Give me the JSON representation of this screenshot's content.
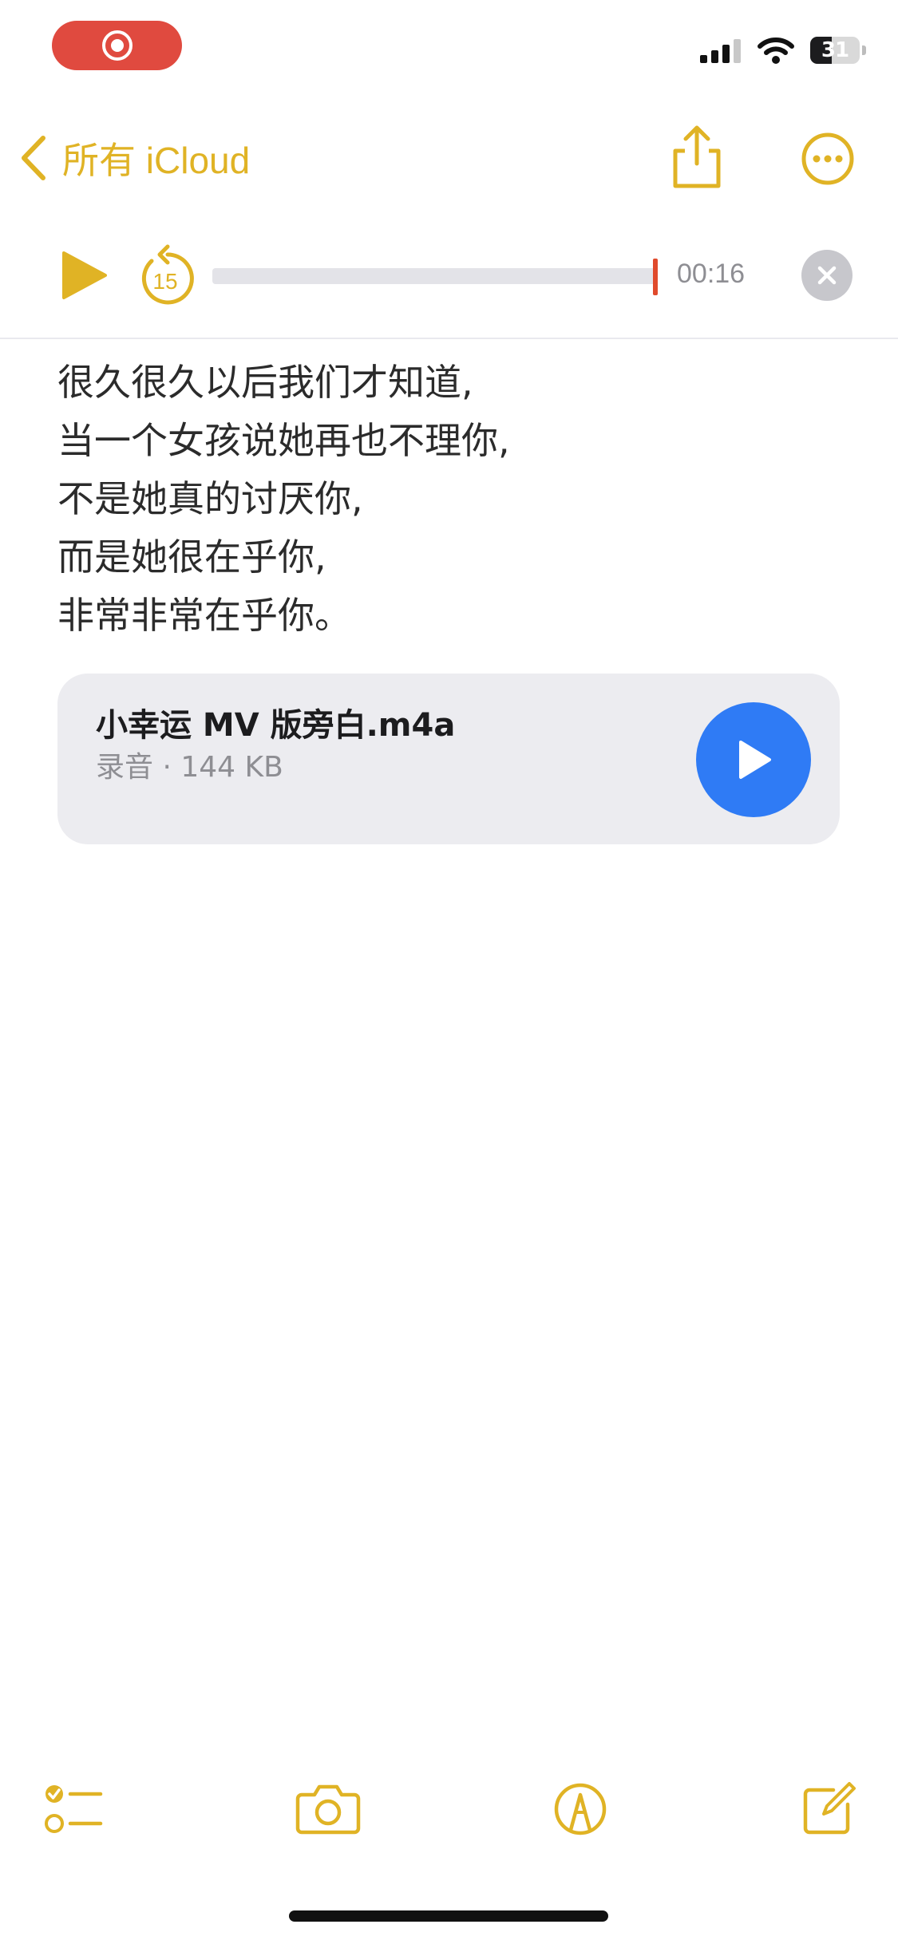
{
  "status_bar": {
    "battery_level": "31",
    "icons": [
      "screen-record-icon",
      "signal-icon",
      "wifi-icon",
      "battery-icon"
    ]
  },
  "nav": {
    "back_label": "所有 iCloud",
    "icons": [
      "chevron-left-icon",
      "share-icon",
      "more-icon"
    ]
  },
  "player": {
    "time": "00:16",
    "progress": 0.98,
    "icons": [
      "play-icon",
      "skip-back-15-icon",
      "close-icon"
    ]
  },
  "note": {
    "lines": [
      "很久很久以后我们才知道,",
      "当一个女孩说她再也不理你,",
      "不是她真的讨厌你,",
      "而是她很在乎你,",
      "非常非常在乎你。"
    ]
  },
  "attachment": {
    "title": "小幸运 MV 版旁白.m4a",
    "meta": "录音 · 144 KB",
    "play_color": "#2f7bf5"
  },
  "toolbar": {
    "icons": [
      "checklist-icon",
      "camera-icon",
      "markup-icon",
      "compose-icon"
    ]
  },
  "colors": {
    "accent": "#e0b325",
    "record": "#e04a3f",
    "playhead": "#e04a2c"
  }
}
